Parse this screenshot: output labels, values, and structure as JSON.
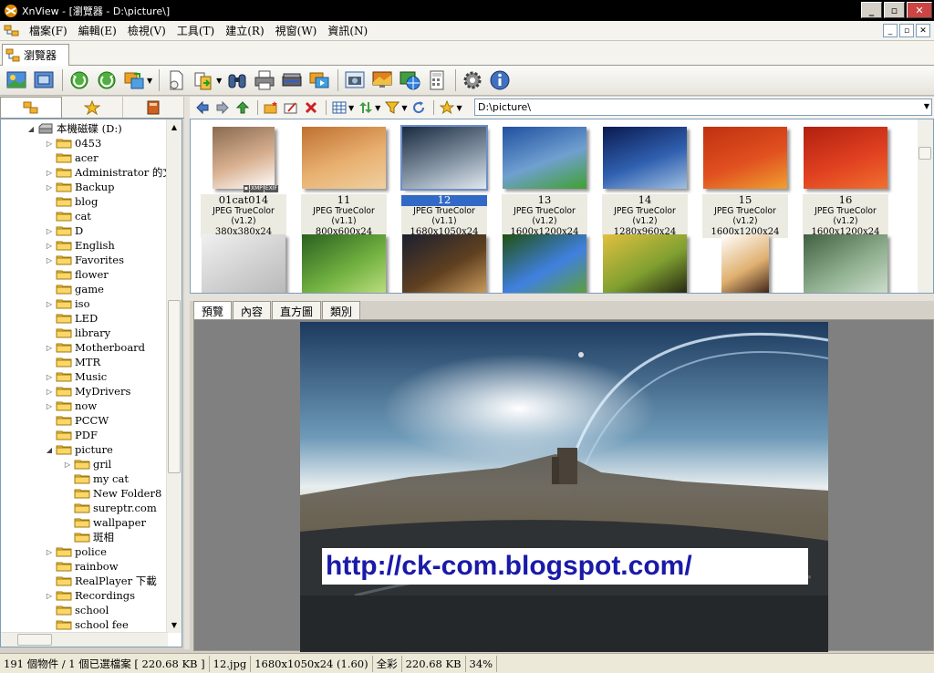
{
  "window": {
    "title": "XnView - [瀏覽器 - D:\\picture\\]",
    "minimize": "_",
    "maximize": "▫",
    "close": "✕"
  },
  "menu": {
    "items": [
      "檔案(F)",
      "編輯(E)",
      "檢視(V)",
      "工具(T)",
      "建立(R)",
      "視窗(W)",
      "資訊(N)"
    ]
  },
  "doc_tab": {
    "label": "瀏覽器"
  },
  "toolbar": {
    "icons": [
      "fullscreen-open-icon",
      "fit-window-icon",
      "rotate-left-icon",
      "rotate-right-icon",
      "convert-icon",
      "new-page-icon",
      "copy-to-icon",
      "binoculars-icon",
      "print-icon",
      "scanner-icon",
      "slideshow-icon",
      "camera-icon",
      "wallpaper-icon",
      "web-icon",
      "calculator-icon",
      "settings-icon",
      "info-icon"
    ]
  },
  "tree": {
    "root": "本機磁碟 (D:)",
    "folders": [
      {
        "name": "0453",
        "exp": "▷",
        "lvl": 0
      },
      {
        "name": "acer",
        "exp": "",
        "lvl": 0
      },
      {
        "name": "Administrator 的文件",
        "exp": "▷",
        "lvl": 0
      },
      {
        "name": "Backup",
        "exp": "▷",
        "lvl": 0
      },
      {
        "name": "blog",
        "exp": "",
        "lvl": 0
      },
      {
        "name": "cat",
        "exp": "",
        "lvl": 0
      },
      {
        "name": "D",
        "exp": "▷",
        "lvl": 0
      },
      {
        "name": "English",
        "exp": "▷",
        "lvl": 0
      },
      {
        "name": "Favorites",
        "exp": "▷",
        "lvl": 0
      },
      {
        "name": "flower",
        "exp": "",
        "lvl": 0
      },
      {
        "name": "game",
        "exp": "",
        "lvl": 0
      },
      {
        "name": "iso",
        "exp": "▷",
        "lvl": 0
      },
      {
        "name": "LED",
        "exp": "",
        "lvl": 0
      },
      {
        "name": "library",
        "exp": "",
        "lvl": 0
      },
      {
        "name": "Motherboard",
        "exp": "▷",
        "lvl": 0
      },
      {
        "name": "MTR",
        "exp": "",
        "lvl": 0
      },
      {
        "name": "Music",
        "exp": "▷",
        "lvl": 0
      },
      {
        "name": "MyDrivers",
        "exp": "▷",
        "lvl": 0
      },
      {
        "name": "now",
        "exp": "▷",
        "lvl": 0
      },
      {
        "name": "PCCW",
        "exp": "",
        "lvl": 0
      },
      {
        "name": "PDF",
        "exp": "",
        "lvl": 0
      },
      {
        "name": "picture",
        "exp": "◢",
        "lvl": 0
      },
      {
        "name": "gril",
        "exp": "▷",
        "lvl": 1
      },
      {
        "name": "my cat",
        "exp": "",
        "lvl": 1
      },
      {
        "name": "New Folder8",
        "exp": "",
        "lvl": 1
      },
      {
        "name": "sureptr.com",
        "exp": "",
        "lvl": 1
      },
      {
        "name": "wallpaper",
        "exp": "",
        "lvl": 1
      },
      {
        "name": "斑相",
        "exp": "",
        "lvl": 1
      },
      {
        "name": "police",
        "exp": "▷",
        "lvl": 0
      },
      {
        "name": "rainbow",
        "exp": "",
        "lvl": 0
      },
      {
        "name": "RealPlayer 下載",
        "exp": "",
        "lvl": 0
      },
      {
        "name": "Recordings",
        "exp": "▷",
        "lvl": 0
      },
      {
        "name": "school",
        "exp": "",
        "lvl": 0
      },
      {
        "name": "school fee",
        "exp": "",
        "lvl": 0
      }
    ]
  },
  "path": {
    "value": "D:\\picture\\"
  },
  "thumbnails": [
    {
      "name": "01cat014",
      "format": "JPEG TrueColor (v1.2)",
      "dims": "380x380x24",
      "badges": [
        "▪",
        "XMP",
        "EXIF"
      ]
    },
    {
      "name": "11",
      "format": "JPEG TrueColor (v1.1)",
      "dims": "800x600x24",
      "badges": []
    },
    {
      "name": "12",
      "format": "JPEG TrueColor (v1.1)",
      "dims": "1680x1050x24",
      "badges": [],
      "selected": true
    },
    {
      "name": "13",
      "format": "JPEG TrueColor (v1.2)",
      "dims": "1600x1200x24",
      "badges": []
    },
    {
      "name": "14",
      "format": "JPEG TrueColor (v1.2)",
      "dims": "1280x960x24",
      "badges": []
    },
    {
      "name": "15",
      "format": "JPEG TrueColor (v1.2)",
      "dims": "1600x1200x24",
      "badges": []
    },
    {
      "name": "16",
      "format": "JPEG TrueColor (v1.2)",
      "dims": "1600x1200x24",
      "badges": []
    }
  ],
  "preview_tabs": [
    "預覽",
    "內容",
    "直方圖",
    "類別"
  ],
  "preview": {
    "watermark": "http://ck-com.blogspot.com/"
  },
  "status": {
    "objects": "191 個物件 / 1 個已選檔案  [ 220.68 KB ]",
    "file": "12.jpg",
    "dims": "1680x1050x24 (1.60)",
    "color": "全彩",
    "size": "220.68 KB",
    "zoom": "34%"
  }
}
